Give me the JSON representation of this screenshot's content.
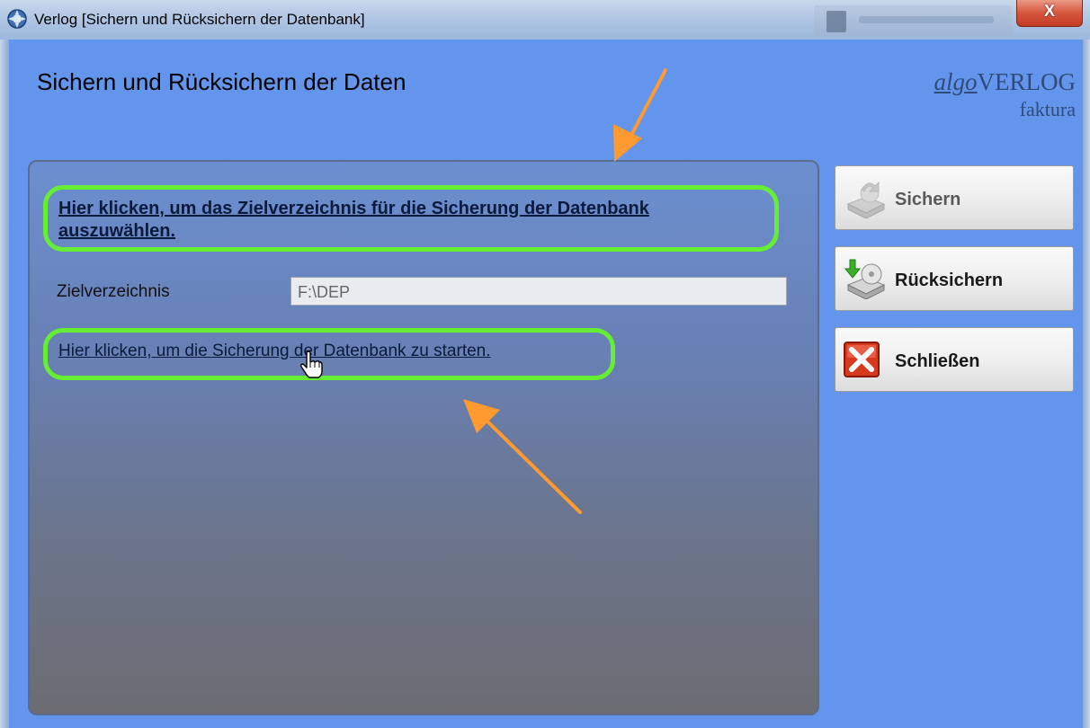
{
  "window": {
    "title": "Verlog [Sichern und Rücksichern der Datenbank]",
    "close_glyph": "X"
  },
  "page": {
    "heading": "Sichern und Rücksichern der Daten"
  },
  "logo": {
    "algo": "algo",
    "verlog": "VERLOG",
    "faktura": "faktura"
  },
  "panel": {
    "choose_dir_link": "Hier klicken, um das Zielverzeichnis für die Sicherung der Datenbank auszuwählen.",
    "target_dir_label": "Zielverzeichnis",
    "target_dir_value": "F:\\DEP",
    "start_backup_link": "Hier klicken, um die Sicherung der Datenbank zu starten."
  },
  "buttons": {
    "backup": {
      "label": "Sichern",
      "icon": "disk-backup-icon",
      "enabled": false
    },
    "restore": {
      "label": "Rücksichern",
      "icon": "disk-restore-icon",
      "enabled": true
    },
    "close": {
      "label": "Schließen",
      "icon": "close-icon",
      "enabled": true
    }
  },
  "annotations": {
    "highlight_color": "#66ee33",
    "arrow_color": "#ff9a30"
  }
}
